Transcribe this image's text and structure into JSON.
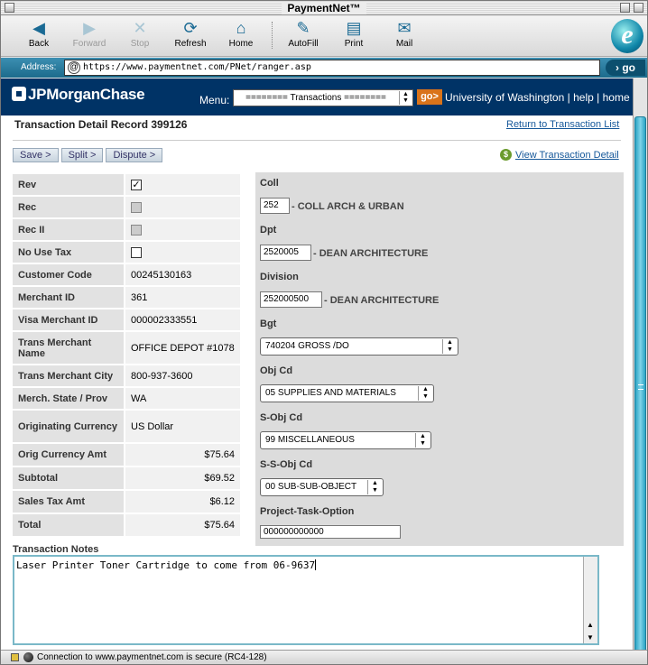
{
  "window": {
    "title": "PaymentNet™"
  },
  "toolbar": {
    "buttons": [
      {
        "label": "Back",
        "icon": "back-arrow-icon"
      },
      {
        "label": "Forward",
        "icon": "forward-arrow-icon"
      },
      {
        "label": "Stop",
        "icon": "stop-x-icon"
      },
      {
        "label": "Refresh",
        "icon": "refresh-icon"
      },
      {
        "label": "Home",
        "icon": "home-icon"
      },
      {
        "label": "AutoFill",
        "icon": "autofill-icon"
      },
      {
        "label": "Print",
        "icon": "print-icon"
      },
      {
        "label": "Mail",
        "icon": "mail-icon"
      }
    ]
  },
  "address": {
    "label": "Address:",
    "url": "https://www.paymentnet.com/PNet/ranger.asp",
    "go": "go"
  },
  "header": {
    "logo": "JPMorganChase",
    "menu_label": "Menu:",
    "menu_value": "======== Transactions ========",
    "go": "go>",
    "org": "University of Washington",
    "help": "help",
    "home": "home",
    "sep": "|"
  },
  "record": {
    "title": "Transaction Detail Record 399126",
    "return_link": "Return to Transaction List",
    "view_detail": "View Transaction Detail",
    "actions": {
      "save": "Save >",
      "split": "Split >",
      "dispute": "Dispute >"
    }
  },
  "info": [
    {
      "label": "Rev",
      "type": "check",
      "checked": true
    },
    {
      "label": "Rec",
      "type": "check-disabled"
    },
    {
      "label": "Rec II",
      "type": "check-disabled"
    },
    {
      "label": "No Use Tax",
      "type": "check",
      "checked": false
    },
    {
      "label": "Customer Code",
      "value": "00245130163"
    },
    {
      "label": "Merchant ID",
      "value": "361"
    },
    {
      "label": "Visa Merchant ID",
      "value": "000002333551"
    },
    {
      "label": "Trans Merchant Name",
      "value": "OFFICE DEPOT #1078"
    },
    {
      "label": "Trans Merchant City",
      "value": "800-937-3600"
    },
    {
      "label": "Merch. State / Prov",
      "value": "WA"
    },
    {
      "label": "Originating Currency",
      "value": "US Dollar"
    },
    {
      "label": "Orig Currency Amt",
      "value": "$75.64"
    },
    {
      "label": "Subtotal",
      "value": "$69.52"
    },
    {
      "label": "Sales Tax Amt",
      "value": "$6.12"
    },
    {
      "label": "Total",
      "value": "$75.64"
    }
  ],
  "coding": {
    "coll_label": "Coll",
    "coll_value": "252",
    "coll_desc": "- COLL ARCH & URBAN",
    "dpt_label": "Dpt",
    "dpt_value": "2520005",
    "dpt_desc": "- DEAN ARCHITECTURE",
    "div_label": "Division",
    "div_value": "252000500",
    "div_desc": "- DEAN ARCHITECTURE",
    "bgt_label": "Bgt",
    "bgt_value": "740204 GROSS /DO",
    "obj_label": "Obj Cd",
    "obj_value": "05 SUPPLIES AND MATERIALS",
    "sobj_label": "S-Obj Cd",
    "sobj_value": "99 MISCELLANEOUS",
    "ssobj_label": "S-S-Obj Cd",
    "ssobj_value": "00 SUB-SUB-OBJECT",
    "pto_label": "Project-Task-Option",
    "pto_value": "000000000000"
  },
  "notes": {
    "label": "Transaction Notes",
    "text": "Laser Printer Toner Cartridge to come from 06-9637"
  },
  "status": {
    "message": "Connection to www.paymentnet.com is secure (RC4-128)"
  }
}
